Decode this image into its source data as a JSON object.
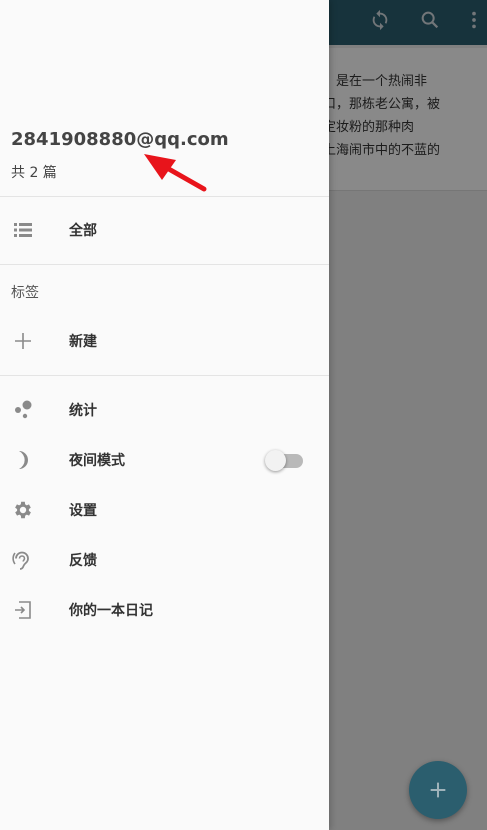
{
  "background": {
    "card_text": "家，是在一个热闹非\n路口，那栋老公寓，被\n人定妆粉的那种肉\n在上海闹市中的不蓝的\n”",
    "icons": [
      "sync-icon",
      "search-icon",
      "more-vert-icon",
      "add-icon"
    ],
    "toolbar_color": "#2b5e6e"
  },
  "drawer": {
    "account_email": "2841908880@qq.com",
    "entry_count": "共 2 篇",
    "all_label": "全部",
    "tags_section_label": "标签",
    "new_tag_label": "新建",
    "stats_label": "统计",
    "night_mode_label": "夜间模式",
    "night_mode_on": false,
    "settings_label": "设置",
    "feedback_label": "反馈",
    "diary_label": "你的一本日记"
  },
  "annotation": {
    "arrow_color": "#e8141b"
  }
}
